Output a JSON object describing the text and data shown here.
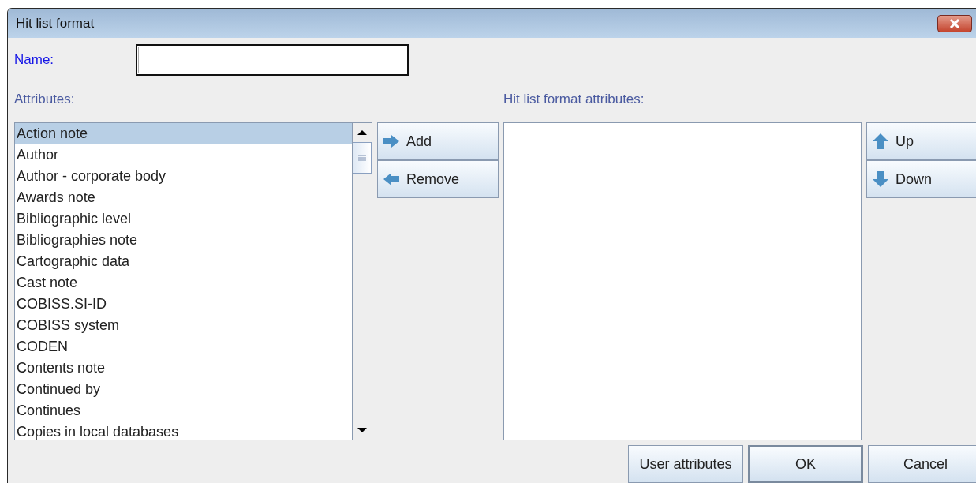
{
  "window": {
    "title": "Hit list format"
  },
  "name_field": {
    "label": "Name:"
  },
  "attributes": {
    "label": "Attributes:",
    "items": [
      {
        "label": "Action note",
        "selected": true
      },
      {
        "label": "Author",
        "selected": false
      },
      {
        "label": "Author - corporate body",
        "selected": false
      },
      {
        "label": "Awards note",
        "selected": false
      },
      {
        "label": "Bibliographic level",
        "selected": false
      },
      {
        "label": "Bibliographies note",
        "selected": false
      },
      {
        "label": "Cartographic data",
        "selected": false
      },
      {
        "label": "Cast note",
        "selected": false
      },
      {
        "label": "COBISS.SI-ID",
        "selected": false
      },
      {
        "label": "COBISS system",
        "selected": false
      },
      {
        "label": "CODEN",
        "selected": false
      },
      {
        "label": "Contents note",
        "selected": false
      },
      {
        "label": "Continued by",
        "selected": false
      },
      {
        "label": "Continues",
        "selected": false
      },
      {
        "label": "Copies in local databases",
        "selected": false
      }
    ]
  },
  "move_buttons": [
    {
      "label": "Add",
      "kind": "right"
    },
    {
      "label": "Remove",
      "kind": "left"
    }
  ],
  "format_attributes": {
    "label": "Hit list format attributes:"
  },
  "order_buttons": [
    {
      "label": "Up",
      "kind": "up"
    },
    {
      "label": "Down",
      "kind": "down"
    }
  ],
  "footer_buttons": [
    {
      "label": "User attributes",
      "default": false
    },
    {
      "label": "OK",
      "default": true
    },
    {
      "label": "Cancel",
      "default": false
    }
  ]
}
